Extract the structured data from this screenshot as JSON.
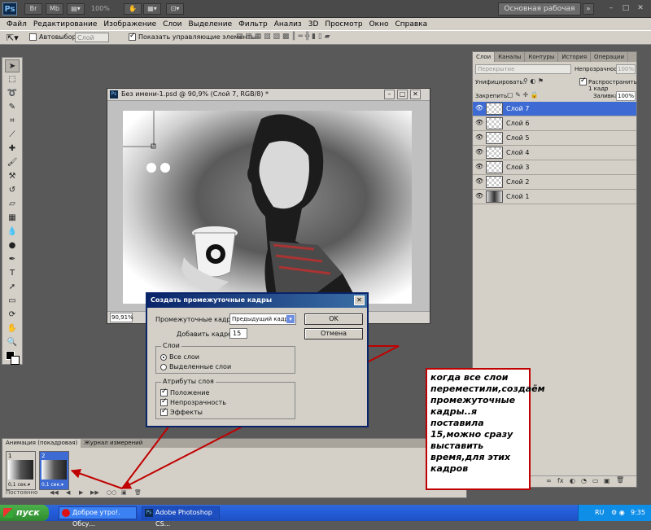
{
  "app": {
    "logo": "Ps",
    "zoom": "100%",
    "workspace": "Основная рабочая среда",
    "window_controls": [
      "–",
      "□",
      "✕"
    ]
  },
  "menu": [
    "Файл",
    "Редактирование",
    "Изображение",
    "Слои",
    "Выделение",
    "Фильтр",
    "Анализ",
    "3D",
    "Просмотр",
    "Окно",
    "Справка"
  ],
  "options_bar": {
    "autoselect_label": "Автовыбор:",
    "autoselect_value": "Слой",
    "show_transform_label": "Показать управляющие элементы"
  },
  "document": {
    "title": "Без имени-1.psd @ 90,9% (Слой 7, RGB/8) *",
    "zoom_status": "90,91%"
  },
  "layers_panel": {
    "tabs": [
      "Слои",
      "Каналы",
      "Контуры",
      "История",
      "Операции"
    ],
    "blend_mode": "Перекрытие",
    "opacity_label": "Непрозрачность:",
    "opacity_value": "100%",
    "unify_label": "Унифицировать:",
    "propagate_label": "Распространить 1 кадр",
    "lock_label": "Закрепить:",
    "fill_label": "Заливка:",
    "fill_value": "100%",
    "layers": [
      {
        "name": "Слой 7",
        "active": true
      },
      {
        "name": "Слой 6",
        "active": false
      },
      {
        "name": "Слой 5",
        "active": false
      },
      {
        "name": "Слой 4",
        "active": false
      },
      {
        "name": "Слой 3",
        "active": false
      },
      {
        "name": "Слой 2",
        "active": false
      },
      {
        "name": "Слой 1",
        "active": false
      }
    ],
    "bottom_icons": [
      "∞",
      "fx",
      "◐",
      "◔",
      "▭",
      "▣",
      "🗑"
    ]
  },
  "dialog": {
    "title": "Создать промежуточные кадры",
    "tween_with_label": "Промежуточные кадры:",
    "tween_with_value": "Предыдущий кадр",
    "frames_to_add_label": "Добавить кадров:",
    "frames_to_add_value": "15",
    "ok": "OK",
    "cancel": "Отмена",
    "layers_group": "Слои",
    "all_layers": "Все слои",
    "selected_layers": "Выделенные слои",
    "attributes_group": "Атрибуты слоя",
    "position": "Положение",
    "opacity": "Непрозрачность",
    "effects": "Эффекты"
  },
  "animation_panel": {
    "tabs": [
      "Анимация (покадровая)",
      "Журнал измерений"
    ],
    "frames": [
      {
        "number": "1",
        "delay": "0,1 сек.▾"
      },
      {
        "number": "2",
        "delay": "0,1 сек.▾"
      }
    ],
    "loop": "Постоянно",
    "controls": [
      "◀◀",
      "◀",
      "▶",
      "▶▶",
      "○○",
      "▣",
      "🗑"
    ]
  },
  "callout": {
    "text": "когда все слои переместили,создаём промежуточные кадры..я поставила 15,можно сразу выставить время,для этих кадров"
  },
  "taskbar": {
    "start": "пуск",
    "items": [
      "Доброе утро!. Обсу...",
      "Adobe Photoshop CS..."
    ],
    "lang": "RU",
    "time": "9:35"
  },
  "colors": {
    "accent_blue": "#3d6bd3",
    "annotation_red": "#c00000",
    "taskbar_blue": "#245edb"
  }
}
